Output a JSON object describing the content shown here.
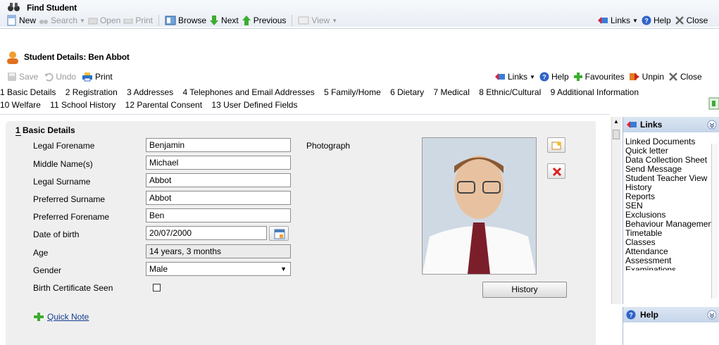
{
  "window": {
    "title": "Find Student"
  },
  "main_toolbar": {
    "new": "New",
    "search": "Search",
    "open": "Open",
    "print": "Print",
    "browse": "Browse",
    "next": "Next",
    "previous": "Previous",
    "view": "View",
    "links": "Links",
    "help": "Help",
    "close": "Close"
  },
  "details": {
    "title": "Student Details: Ben Abbot",
    "toolbar": {
      "save": "Save",
      "undo": "Undo",
      "print": "Print",
      "links": "Links",
      "help": "Help",
      "favourites": "Favourites",
      "unpin": "Unpin",
      "close": "Close"
    },
    "tabs_row1": [
      "1 Basic Details",
      "2 Registration",
      "3 Addresses",
      "4 Telephones and Email Addresses",
      "5 Family/Home",
      "6 Dietary",
      "7 Medical",
      "8 Ethnic/Cultural",
      "9 Additional Information"
    ],
    "tabs_row2": [
      "10 Welfare",
      "11 School History",
      "12 Parental Consent",
      "13 User Defined Fields"
    ]
  },
  "basic": {
    "section_title": "1 Basic Details",
    "legal_forename_label": "Legal Forename",
    "legal_forename": "Benjamin",
    "middle_label": "Middle Name(s)",
    "middle": "Michael",
    "legal_surname_label": "Legal Surname",
    "legal_surname": "Abbot",
    "pref_surname_label": "Preferred Surname",
    "pref_surname": "Abbot",
    "pref_forename_label": "Preferred Forename",
    "pref_forename": "Ben",
    "dob_label": "Date of birth",
    "dob": "20/07/2000",
    "age_label": "Age",
    "age": "14 years, 3 months",
    "gender_label": "Gender",
    "gender": "Male",
    "birth_cert_label": "Birth Certificate Seen",
    "photo_label": "Photograph",
    "history_button": "History",
    "quick_note": "Quick Note"
  },
  "sidebar": {
    "links_title": "Links",
    "links": [
      "Linked Documents",
      "Quick letter",
      "Data Collection Sheet",
      "Send Message",
      "Student Teacher View",
      "History",
      "Reports",
      "SEN",
      "Exclusions",
      "Behaviour Management",
      "Timetable",
      "Classes",
      "Attendance",
      "Assessment",
      "Examinations"
    ],
    "help_title": "Help"
  }
}
